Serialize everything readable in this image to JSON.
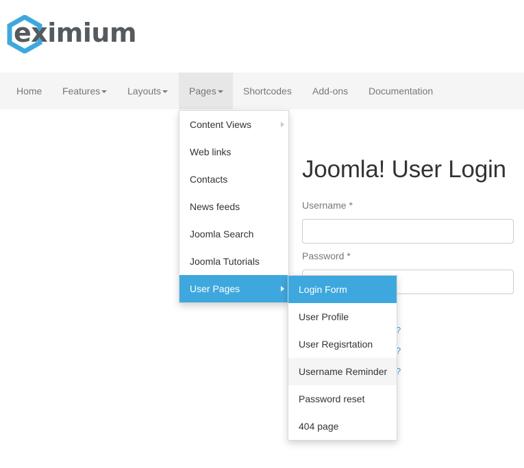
{
  "brand": {
    "name": "eximium",
    "colors": {
      "hex": "#3ea8de",
      "text": "#555a5f"
    }
  },
  "nav": {
    "items": [
      {
        "label": "Home"
      },
      {
        "label": "Features",
        "dropdown": true
      },
      {
        "label": "Layouts",
        "dropdown": true
      },
      {
        "label": "Pages",
        "dropdown": true,
        "active": true
      },
      {
        "label": "Shortcodes"
      },
      {
        "label": "Add-ons"
      },
      {
        "label": "Documentation"
      }
    ]
  },
  "pages_menu": {
    "items": [
      {
        "label": "Content Views",
        "has_submenu": true
      },
      {
        "label": "Web links"
      },
      {
        "label": "Contacts"
      },
      {
        "label": "News feeds"
      },
      {
        "label": "Joomla Search"
      },
      {
        "label": "Joomla Tutorials"
      },
      {
        "label": "User Pages",
        "has_submenu": true,
        "active": true
      }
    ]
  },
  "user_pages_menu": {
    "items": [
      {
        "label": "Login Form",
        "active": true
      },
      {
        "label": "User Profile"
      },
      {
        "label": "User Regisrtation"
      },
      {
        "label": "Username Reminder",
        "hovered": true
      },
      {
        "label": "Password reset"
      },
      {
        "label": "404 page"
      }
    ]
  },
  "login": {
    "title": "Joomla! User Login",
    "username_label": "Username *",
    "username_value": "",
    "password_label": "Password *",
    "password_value": "",
    "link_fragments": [
      "?",
      "?",
      "?"
    ]
  },
  "colors": {
    "accent": "#3ea8de",
    "nav_bg": "#f5f5f5",
    "nav_active_bg": "#e7e7e7",
    "link": "#3ba2d9"
  }
}
